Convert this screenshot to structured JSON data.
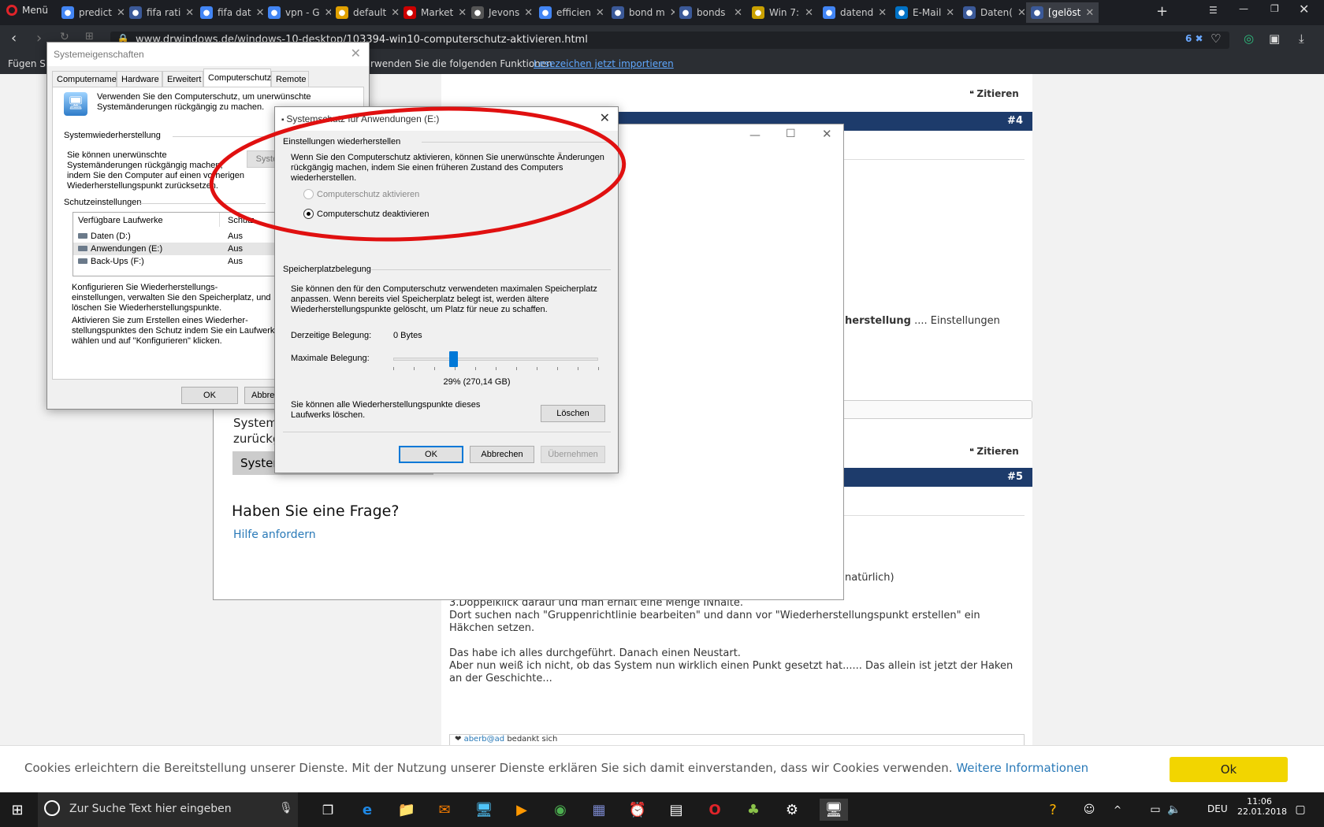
{
  "browser": {
    "menu_label": "Menü",
    "tabs": [
      {
        "label": "predict",
        "color": "#4285f4"
      },
      {
        "label": "fifa rati",
        "color": "#3b5998"
      },
      {
        "label": "fifa dat",
        "color": "#4285f4"
      },
      {
        "label": "vpn - G",
        "color": "#4285f4"
      },
      {
        "label": "default",
        "color": "#e0a000"
      },
      {
        "label": "Market",
        "color": "#cc0000"
      },
      {
        "label": "Jevons",
        "color": "#555555"
      },
      {
        "label": "efficien",
        "color": "#4285f4"
      },
      {
        "label": "bond m",
        "color": "#3b5998"
      },
      {
        "label": "bonds",
        "color": "#3b5998"
      },
      {
        "label": "Win 7:",
        "color": "#c9a000"
      },
      {
        "label": "datend",
        "color": "#4285f4"
      },
      {
        "label": "E-Mail",
        "color": "#0072c6"
      },
      {
        "label": "Daten(",
        "color": "#3b5998"
      },
      {
        "label": "[gelöst",
        "color": "#3b5998"
      }
    ],
    "url": "www.drwindows.de/windows-10-desktop/103394-win10-computerschutz-aktivieren.html",
    "badge_count": "6",
    "bookmark_prefix": "Fügen Sie",
    "bookmark_text": "rwenden Sie die folgenden Funktionen",
    "bookmark_link": "Lesezeichen jetzt importieren"
  },
  "forum": {
    "quote_label": "Zitieren",
    "post4": "#4",
    "post5": "#5",
    "snippet_bold": "herstellung",
    "snippet_rest": ".... Einstellungen",
    "snippet_natural": "natürlich)",
    "post_lines": [
      "3.Doppelklick darauf und man erhält eine Menge INhalte.",
      "Dort suchen nach \"Gruppenrichtlinie bearbeiten\" und dann vor \"Wiederherstellungspunkt erstellen\" ein",
      "Häkchen setzen.",
      "",
      "Das habe ich alles durchgeführt. Danach einen Neustart.",
      "Aber nun weiß ich nicht, ob das System nun wirklich einen Punkt gesetzt hat...... Das allein ist jetzt der Haken",
      "an der Geschichte..."
    ],
    "thanks_user": "aberb@ad",
    "thanks_text": "bedankt sich",
    "left_partial1": "Systemc",
    "left_partial2": "zurückg",
    "left_button_partial": "System",
    "question_heading": "Haben Sie eine Frage?",
    "help_link": "Hilfe anfordern"
  },
  "sysprops": {
    "title": "Systemeigenschaften",
    "tabs": [
      "Computername",
      "Hardware",
      "Erweitert",
      "Computerschutz",
      "Remote"
    ],
    "intro": [
      "Verwenden Sie den Computerschutz, um unerwünschte",
      "Systemänderungen rückgängig zu machen."
    ],
    "restore_group": "Systemwiederherstellung",
    "restore_text": [
      "Sie können unerwünschte",
      "Systemänderungen rückgängig machen,",
      "indem Sie den Computer auf einen vorherigen",
      "Wiederherstellungspunkt zurücksetzen."
    ],
    "restore_button": "System",
    "protect_group": "Schutzeinstellungen",
    "col_drives": "Verfügbare Laufwerke",
    "col_protect": "Schutz",
    "drives": [
      {
        "name": "Daten (D:)",
        "state": "Aus"
      },
      {
        "name": "Anwendungen (E:)",
        "state": "Aus"
      },
      {
        "name": "Back-Ups (F:)",
        "state": "Aus"
      }
    ],
    "config_text": [
      "Konfigurieren Sie Wiederherstellungs-",
      "einstellungen, verwalten Sie den Speicherplatz, und",
      "löschen Sie Wiederherstellungspunkte."
    ],
    "create_text": [
      "Aktivieren Sie zum Erstellen eines Wiederher-",
      "stellungspunktes den Schutz indem Sie ein Laufwerk",
      "wählen und auf \"Konfigurieren\" klicken."
    ],
    "ok": "OK",
    "cancel": "Abbre"
  },
  "dialog": {
    "title": "Systemschutz für Anwendungen (E:)",
    "restore_group": "Einstellungen wiederherstellen",
    "restore_text": [
      "Wenn Sie den Computerschutz aktivieren, können Sie unerwünschte Änderungen",
      "rückgängig machen, indem Sie einen früheren Zustand des Computers",
      "wiederherstellen."
    ],
    "radio_on": "Computerschutz aktivieren",
    "radio_off": "Computerschutz deaktivieren",
    "space_group": "Speicherplatzbelegung",
    "space_text": [
      "Sie können den für den Computerschutz verwendeten maximalen Speicherplatz",
      "anpassen. Wenn bereits viel Speicherplatz belegt ist, werden ältere",
      "Wiederherstellungspunkte gelöscht, um Platz für neue zu schaffen."
    ],
    "current_label": "Derzeitige Belegung:",
    "current_value": "0 Bytes",
    "max_label": "Maximale Belegung:",
    "slider_percent": 0.29,
    "slider_text": "29% (270,14 GB)",
    "delete_text": [
      "Sie können alle Wiederherstellungspunkte dieses",
      "Laufwerks löschen."
    ],
    "delete": "Löschen",
    "ok": "OK",
    "cancel": "Abbrechen",
    "apply": "Übernehmen"
  },
  "cookie": {
    "text": "Cookies erleichtern die Bereitstellung unserer Dienste. Mit der Nutzung unserer Dienste erklären Sie sich damit einverstanden, dass wir Cookies verwenden.",
    "link": "Weitere Informationen",
    "ok": "Ok"
  },
  "taskbar": {
    "search_placeholder": "Zur Suche Text hier eingeben",
    "lang": "DEU",
    "time": "11:06",
    "date": "22.01.2018"
  },
  "colors": {
    "accent": "#0078d7",
    "forum_bar": "#1d3b6b",
    "link": "#2a7ab8",
    "cookie_btn": "#f2d500",
    "annotation": "#e01010"
  }
}
